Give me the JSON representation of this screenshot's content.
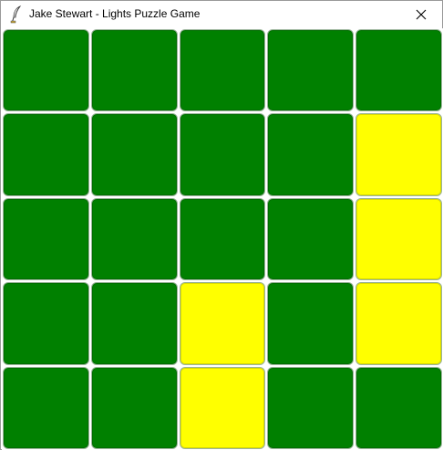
{
  "window": {
    "title": "Jake Stewart - Lights Puzzle Game",
    "app_icon": "feather-quill-icon",
    "close_icon": "close-icon"
  },
  "board": {
    "rows": 5,
    "cols": 5,
    "colors": {
      "off": "#008000",
      "on": "#ffff00"
    },
    "cells": [
      [
        0,
        0,
        0,
        0,
        0
      ],
      [
        0,
        0,
        0,
        0,
        1
      ],
      [
        0,
        0,
        0,
        0,
        1
      ],
      [
        0,
        0,
        1,
        0,
        1
      ],
      [
        0,
        0,
        1,
        0,
        0
      ]
    ]
  }
}
